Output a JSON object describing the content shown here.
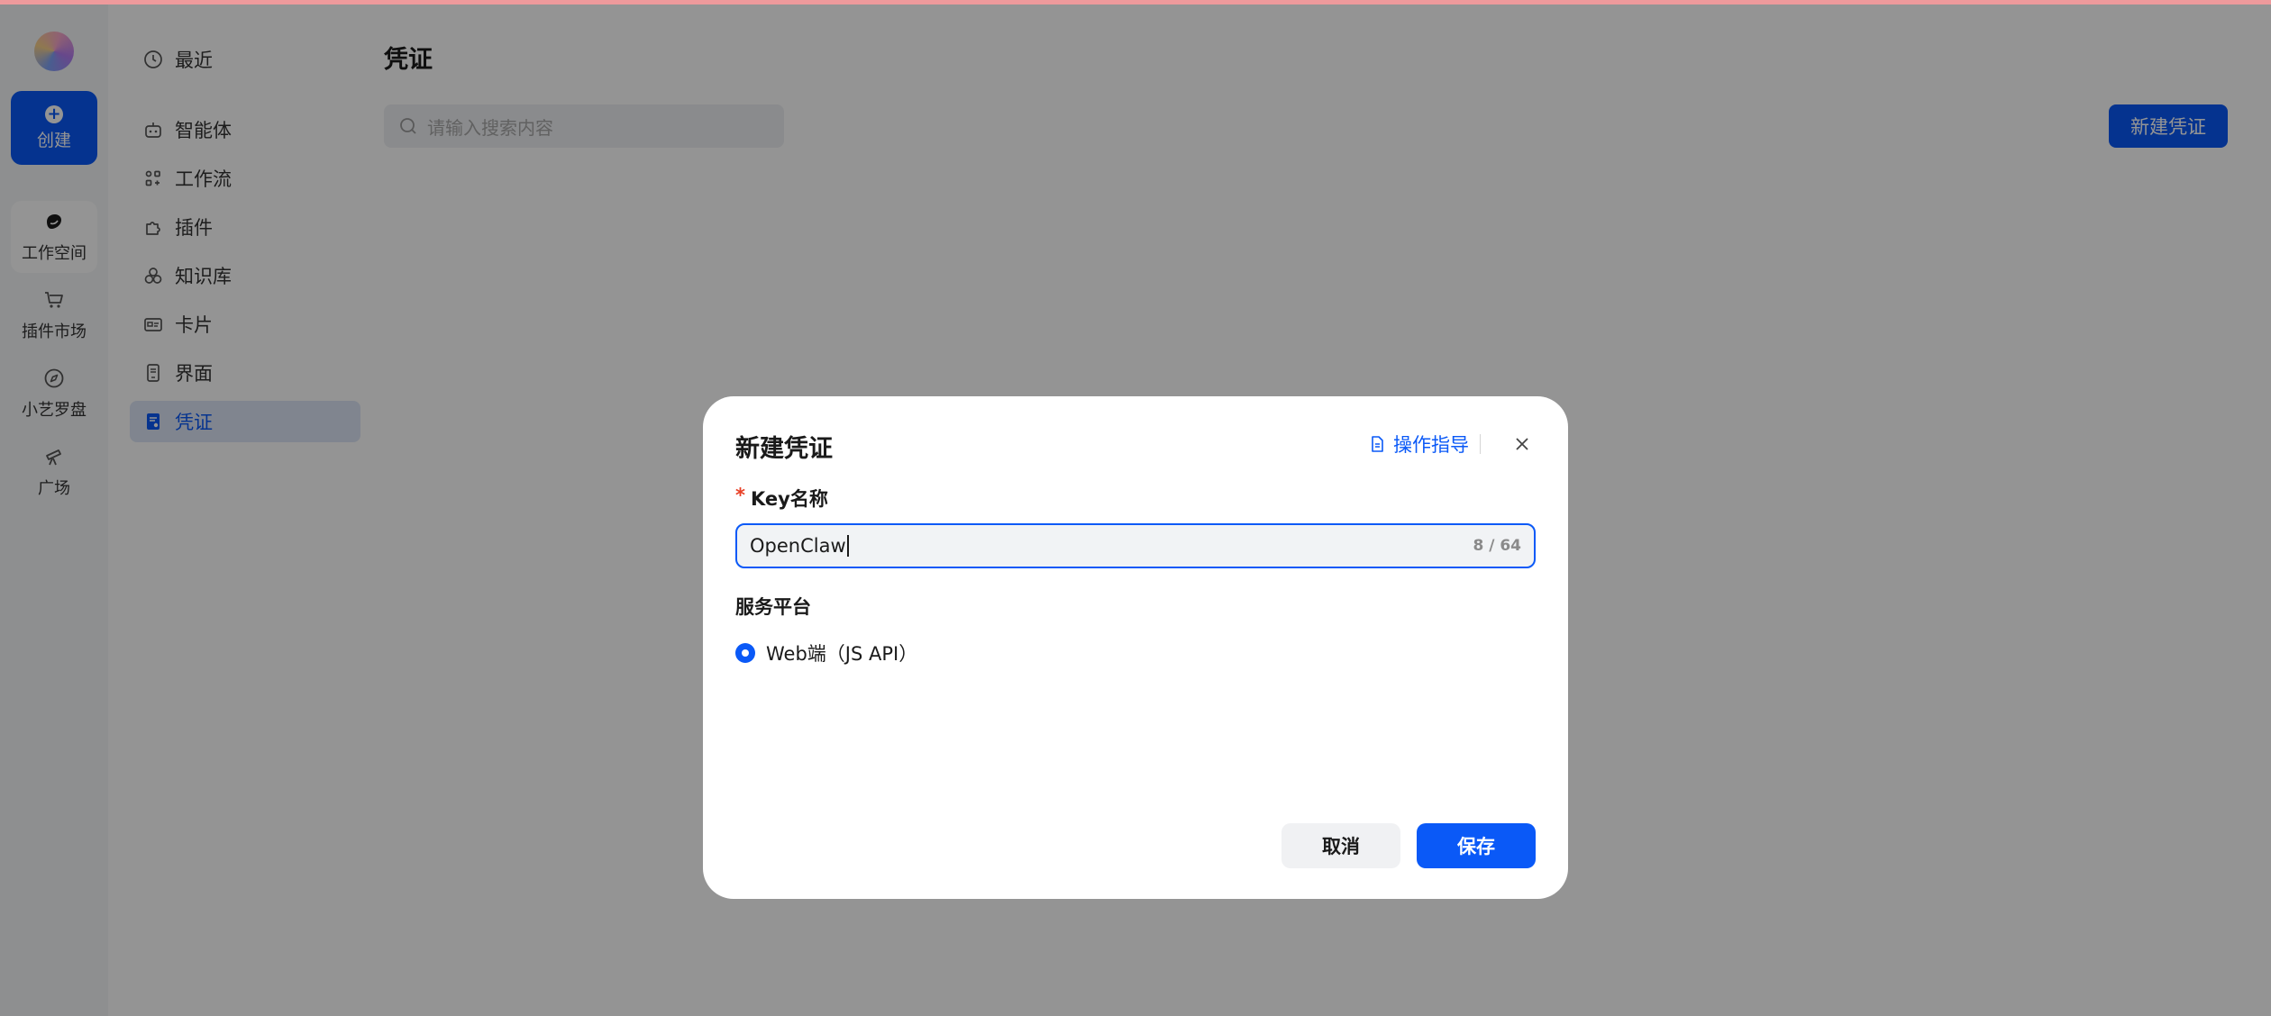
{
  "rail": {
    "create_label": "创建",
    "items": [
      {
        "label": "工作空间",
        "icon": "workspace-icon"
      },
      {
        "label": "插件市场",
        "icon": "cart-icon"
      },
      {
        "label": "小艺罗盘",
        "icon": "compass-icon"
      },
      {
        "label": "广场",
        "icon": "telescope-icon"
      }
    ]
  },
  "sidebar": {
    "items": [
      {
        "label": "最近",
        "icon": "clock-icon"
      },
      {
        "label": "智能体",
        "icon": "robot-icon"
      },
      {
        "label": "工作流",
        "icon": "workflow-icon"
      },
      {
        "label": "插件",
        "icon": "puzzle-icon"
      },
      {
        "label": "知识库",
        "icon": "knowledge-icon"
      },
      {
        "label": "卡片",
        "icon": "card-icon"
      },
      {
        "label": "界面",
        "icon": "phone-icon"
      },
      {
        "label": "凭证",
        "icon": "credential-icon"
      }
    ],
    "active": "凭证"
  },
  "main": {
    "title": "凭证",
    "search_placeholder": "请输入搜索内容",
    "new_button": "新建凭证"
  },
  "modal": {
    "title": "新建凭证",
    "guide_label": "操作指导",
    "key_label": "Key名称",
    "key_required_mark": "*",
    "key_value": "OpenClaw",
    "key_counter": "8 / 64",
    "platform_label": "服务平台",
    "platform_option": "Web端（JS API）",
    "cancel_label": "取消",
    "save_label": "保存"
  },
  "colors": {
    "accent": "#0a59f7",
    "required": "#e84026",
    "overlay": "rgba(0,0,0,0.42)"
  }
}
